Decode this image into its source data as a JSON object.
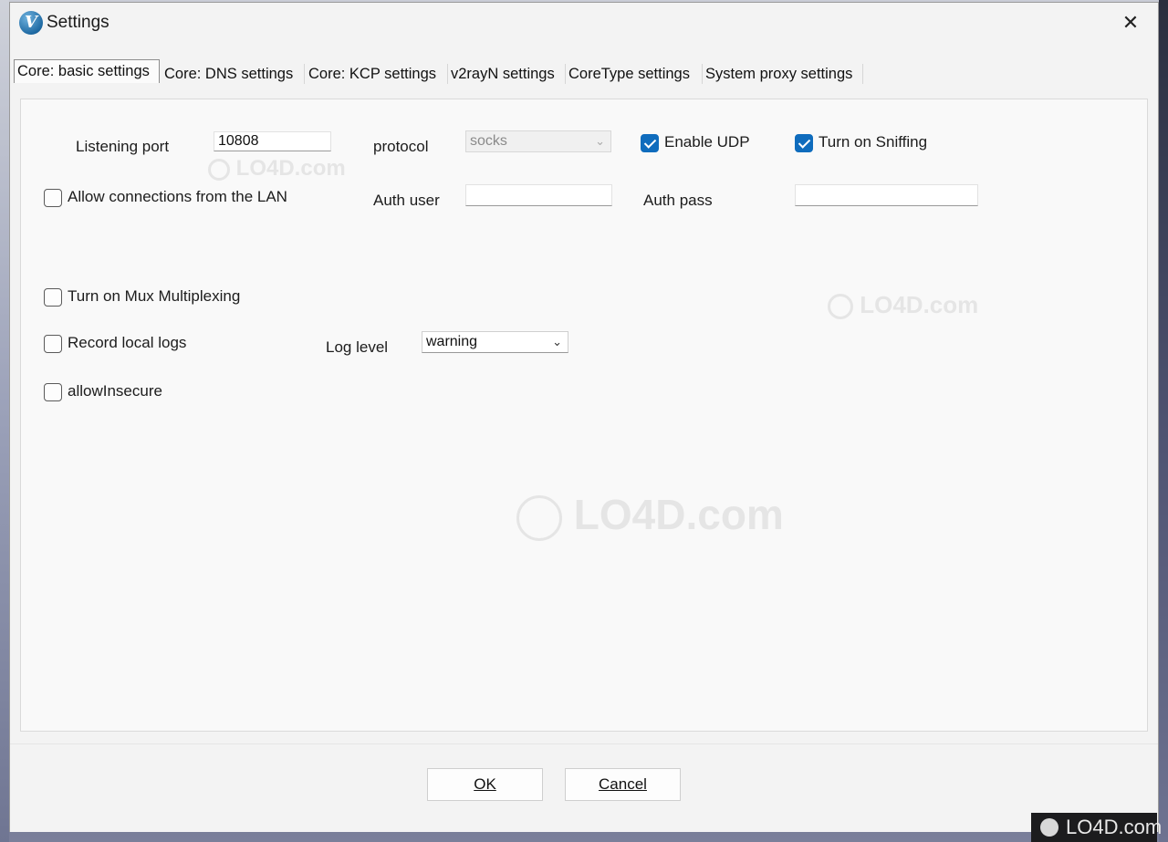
{
  "window": {
    "title": "Settings",
    "close_glyph": "✕",
    "icon_letter": "V"
  },
  "tabs": [
    {
      "label": "Core: basic settings",
      "active": true
    },
    {
      "label": "Core: DNS settings",
      "active": false
    },
    {
      "label": "Core: KCP settings",
      "active": false
    },
    {
      "label": "v2rayN settings",
      "active": false
    },
    {
      "label": "CoreType settings",
      "active": false
    },
    {
      "label": "System proxy settings",
      "active": false
    }
  ],
  "basic": {
    "listening_port_label": "Listening port",
    "listening_port_value": "10808",
    "protocol_label": "protocol",
    "protocol_value": "socks",
    "enable_udp_label": "Enable UDP",
    "enable_udp_checked": true,
    "sniffing_label": "Turn on Sniffing",
    "sniffing_checked": true,
    "allow_lan_label": "Allow connections from the LAN",
    "allow_lan_checked": false,
    "auth_user_label": "Auth user",
    "auth_user_value": "",
    "auth_pass_label": "Auth pass",
    "auth_pass_value": "",
    "mux_label": "Turn on Mux Multiplexing",
    "mux_checked": false,
    "record_logs_label": "Record local logs",
    "record_logs_checked": false,
    "log_level_label": "Log level",
    "log_level_value": "warning",
    "allow_insecure_label": "allowInsecure",
    "allow_insecure_checked": false
  },
  "footer": {
    "ok_label": "OK",
    "cancel_label": "Cancel"
  },
  "watermark": {
    "text": "LO4D.com"
  },
  "badge": {
    "text": "LO4D.com"
  },
  "colors": {
    "accent": "#0f6cbd"
  }
}
